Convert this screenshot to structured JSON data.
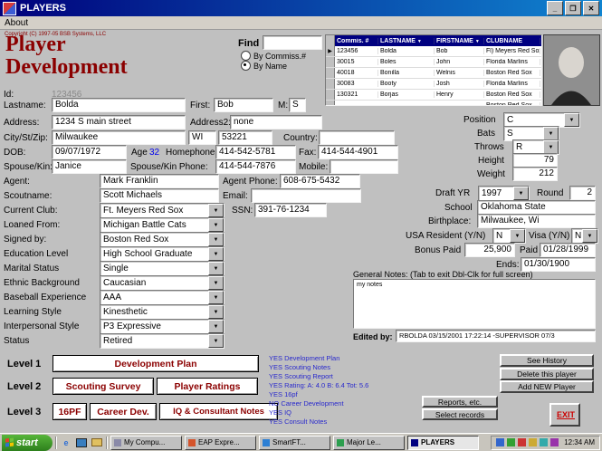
{
  "colors": {
    "accent_maroon": "#8b0000",
    "titlebar_blue": "#00007b",
    "grid_header_navy": "#000080",
    "status_text_blue": "#2929cc",
    "age_blue": "#0000ee",
    "exit_red": "#cc0000",
    "start_green": "#2d7f1c"
  },
  "titlebar": {
    "title": "PLAYERS"
  },
  "menubar": {
    "items": [
      "About"
    ]
  },
  "header": {
    "copyright": "Copyright (C) 1997-05 BSB Systems, LLC",
    "title_line1": "Player",
    "title_line2": "Development",
    "find_label": "Find",
    "find_value": "",
    "radio_commiss": "By Commiss.#",
    "radio_name": "By Name"
  },
  "grid": {
    "headers": {
      "commis": "Commis. #",
      "lastname": "LASTNAME",
      "firstname": "FIRSTNAME",
      "clubname": "CLUBNAME"
    },
    "rows": [
      {
        "commis": "123456",
        "lastname": "Bolda",
        "firstname": "Bob",
        "clubname": "Fl) Meyers Red Sox"
      },
      {
        "commis": "30015",
        "lastname": "Boles",
        "firstname": "John",
        "clubname": "Florida Marlins"
      },
      {
        "commis": "40018",
        "lastname": "Bonilla",
        "firstname": "Welnis",
        "clubname": "Boston Red Sox"
      },
      {
        "commis": "30083",
        "lastname": "Booty",
        "firstname": "Josh",
        "clubname": "Florida Marlins"
      },
      {
        "commis": "130321",
        "lastname": "Borjas",
        "firstname": "Henry",
        "clubname": "Boston Red Sox"
      },
      {
        "commis": "",
        "lastname": "",
        "firstname": "",
        "clubname": "Boston Red Sox"
      }
    ]
  },
  "form": {
    "id": {
      "label": "Id:",
      "value": "123456"
    },
    "lastname": {
      "label": "Lastname:",
      "value": "Bolda"
    },
    "first": {
      "label": "First:",
      "value": "Bob"
    },
    "mi": {
      "label": "M:",
      "value": "S"
    },
    "address": {
      "label": "Address:",
      "value": "1234 S main street"
    },
    "address2": {
      "label": "Address2:",
      "value": "none"
    },
    "citystzip": {
      "label": "City/St/Zip:",
      "city": "Milwaukee",
      "state": "WI",
      "zip": "53221"
    },
    "country": {
      "label": "Country:",
      "value": ""
    },
    "dob": {
      "label": "DOB:",
      "value": "09/07/1972"
    },
    "age": {
      "label": "Age",
      "value": "32"
    },
    "homephone": {
      "label": "Homephone:",
      "value": "414-542-5781"
    },
    "fax": {
      "label": "Fax:",
      "value": "414-544-4901"
    },
    "spousekin": {
      "label": "Spouse/Kin:",
      "value": "Janice"
    },
    "spousephone": {
      "label": "Spouse/Kin Phone:",
      "value": "414-544-7876"
    },
    "mobile": {
      "label": "Mobile:",
      "value": ""
    },
    "agent": {
      "label": "Agent:",
      "value": "Mark Franklin"
    },
    "agentphone": {
      "label": "Agent Phone:",
      "value": "608-675-5432"
    },
    "scoutname": {
      "label": "Scoutname:",
      "value": "Scott Michaels"
    },
    "email": {
      "label": "Email:",
      "value": ""
    },
    "currentclub": {
      "label": "Current Club:",
      "value": "Ft. Meyers Red Sox"
    },
    "ssn": {
      "label": "SSN:",
      "value": "391-76-1234"
    },
    "loanedfrom": {
      "label": "Loaned From:",
      "value": "Michigan Battle Cats"
    },
    "signedby": {
      "label": "Signed by:",
      "value": "Boston Red Sox"
    },
    "education": {
      "label": "Education Level",
      "value": "High School Graduate"
    },
    "marital": {
      "label": "Marital Status",
      "value": "Single"
    },
    "ethnic": {
      "label": "Ethnic Background",
      "value": "Caucasian"
    },
    "baseballexp": {
      "label": "Baseball Experience",
      "value": "AAA"
    },
    "learning": {
      "label": "Learning Style",
      "value": "Kinesthetic"
    },
    "interpersonal": {
      "label": "Interpersonal Style",
      "value": "P3 Expressive"
    },
    "status": {
      "label": "Status",
      "value": "Retired"
    }
  },
  "right": {
    "position": {
      "label": "Position",
      "value": "C"
    },
    "bats": {
      "label": "Bats",
      "value": "S"
    },
    "throws": {
      "label": "Throws",
      "value": "R"
    },
    "height": {
      "label": "Height",
      "value": "79"
    },
    "weight": {
      "label": "Weight",
      "value": "212"
    },
    "draftyr": {
      "label": "Draft YR",
      "value": "1997"
    },
    "round": {
      "label": "Round",
      "value": "2"
    },
    "school": {
      "label": "School",
      "value": "Oklahoma State"
    },
    "birthplace": {
      "label": "Birthplace:",
      "value": "Milwaukee, Wi"
    },
    "usaresident": {
      "label": "USA Resident (Y/N)",
      "value": "N"
    },
    "visa": {
      "label": "Visa (Y/N)",
      "value": "N"
    },
    "bonuspaid": {
      "label": "Bonus Paid",
      "value": "25,900"
    },
    "paid": {
      "label": "Paid",
      "value": "01/28/1999"
    },
    "ends": {
      "label": "Ends:",
      "value": "01/30/1900"
    },
    "notes_label": "General Notes:  (Tab to exit  Dbl-Clk for full screen)",
    "notes_value": "my notes",
    "edited_label": "Edited by:",
    "edited_value": "RBOLDA 03/15/2001 17:22:14  -SUPERVISOR 07/3"
  },
  "levels": {
    "l1": "Level 1",
    "l2": "Level 2",
    "l3": "Level 3",
    "dev_plan": "Development Plan",
    "scouting_survey": "Scouting Survey",
    "player_ratings": "Player Ratings",
    "pf16": "16PF",
    "career_dev": "Career Dev.",
    "iq_notes": "IQ & Consultant Notes"
  },
  "status_lines": [
    "YES Development Plan",
    "YES Scouting Notes",
    "YES Scouting Report",
    "YES Rating:   A:  4.0   B:  6.4  Tot:  5.6",
    "YES 16pf",
    "NO Career Development",
    "YES IQ",
    "YES Consult Notes"
  ],
  "actions": {
    "see_history": "See History",
    "delete_player": "Delete this player",
    "add_new": "Add NEW Player",
    "reports": "Reports, etc.",
    "select_records": "Select records",
    "exit": "EXIT"
  },
  "icons": {
    "dropdown_arrow": "▼",
    "sort_arrow": "▼",
    "row_pointer": "▶",
    "minimize": "_",
    "maximize": "❐",
    "close": "✕"
  },
  "taskbar": {
    "start_label": "start",
    "tasks": [
      "My Compu...",
      "EAP Expre...",
      "SmartFT...",
      "Major Le...",
      "PLAYERS"
    ],
    "clock": "12:34 AM"
  }
}
